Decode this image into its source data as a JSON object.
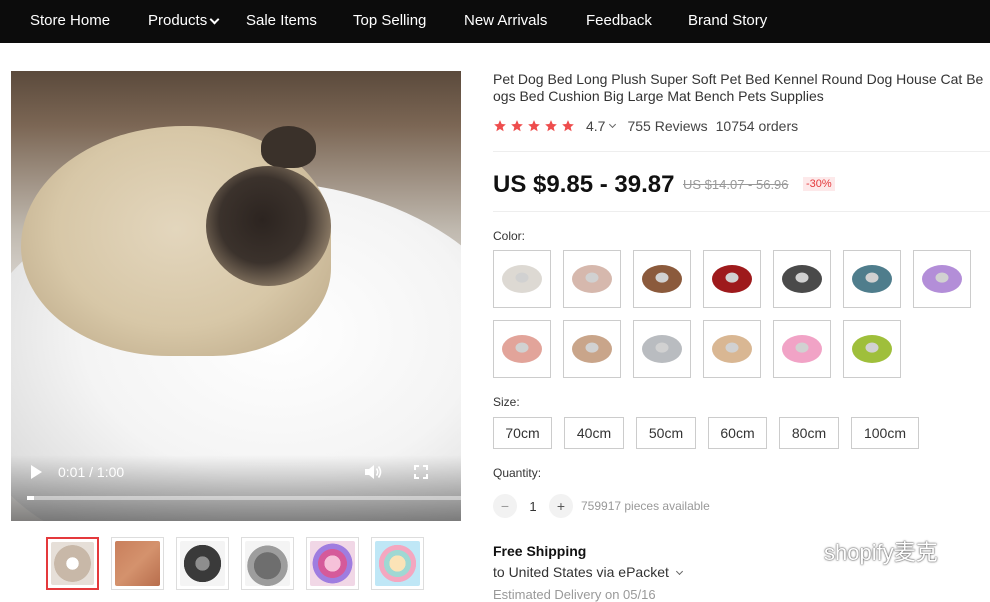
{
  "nav": {
    "items": [
      "Store Home",
      "Products",
      "Sale Items",
      "Top Selling",
      "New Arrivals",
      "Feedback",
      "Brand Story"
    ]
  },
  "video": {
    "time": "0:01 / 1:00",
    "progress_fraction": 0.017
  },
  "gallery": {
    "thumbnails": [
      "video-thumb",
      "plush-blanket",
      "grey-round-bed",
      "grey-plush",
      "pink-multicolor",
      "pastel-multicolor"
    ],
    "active_index": 0
  },
  "product": {
    "title_line1": "Pet Dog Bed Long Plush Super Soft Pet Bed Kennel Round Dog House Cat Be",
    "title_line2": "ogs Bed Cushion Big Large Mat Bench Pets Supplies",
    "rating": "4.7",
    "stars": 5,
    "reviews": "755 Reviews",
    "orders": "10754 orders",
    "price": "US $9.85 - 39.87",
    "old_price": "US $14.07 - 56.96",
    "discount": "-30%"
  },
  "options": {
    "color_label": "Color:",
    "colors": [
      "#ddd9d3",
      "#d6b8ad",
      "#8b5a3c",
      "#9e1a1c",
      "#4a4a4a",
      "#4f7d8c",
      "#b38ed8",
      "#e2a49a",
      "#c9a58a",
      "#b9bcc0",
      "#d9b793",
      "#f1a3c6",
      "#9fbf3b"
    ],
    "size_label": "Size:",
    "sizes": [
      "70cm",
      "40cm",
      "50cm",
      "60cm",
      "80cm",
      "100cm"
    ],
    "quantity_label": "Quantity:",
    "quantity_value": "1",
    "available": "759917 pieces available"
  },
  "shipping": {
    "title": "Free Shipping",
    "sub": "to United States via ePacket",
    "estimated": "Estimated Delivery on 05/16"
  },
  "watermark": {
    "text": "shopify麦克"
  },
  "colors": {
    "nav_bg": "#0c0c0c",
    "accent": "#e4393c",
    "star": "#ee4d4d"
  }
}
